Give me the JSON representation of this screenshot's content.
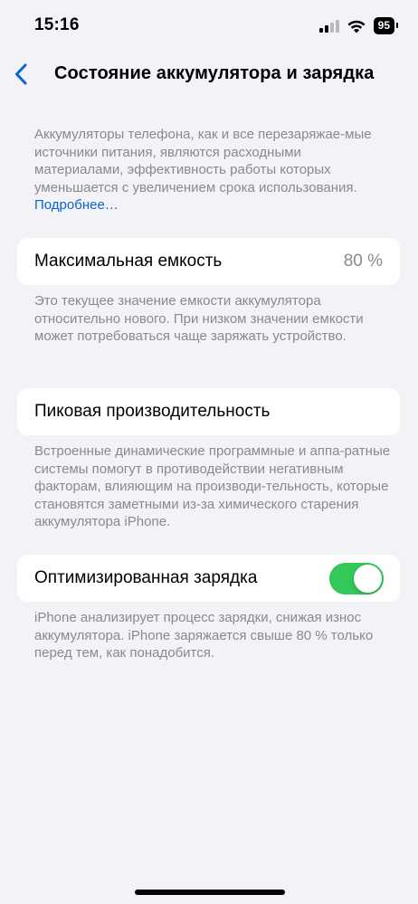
{
  "status_bar": {
    "time": "15:16",
    "battery_level": "95"
  },
  "nav": {
    "back_icon": "chevron-left-icon",
    "title": "Состояние аккумулятора и зарядка"
  },
  "intro": {
    "text": "Аккумуляторы телефона, как и все перезаряжае-мые источники питания, являются расходными материалами, эффективность работы которых уменьшается с увеличением срока использования.",
    "link": "Подробнее…"
  },
  "max_capacity": {
    "label": "Максимальная емкость",
    "value": "80 %",
    "footnote": "Это текущее значение емкости аккумулятора относительно нового. При низком значении емкости может потребоваться чаще заряжать устройство."
  },
  "peak_performance": {
    "label": "Пиковая производительность",
    "footnote": "Встроенные динамические программные и аппа-ратные системы помогут в противодействии негативным факторам, влияющим на производи-тельность, которые становятся заметными из-за химического старения аккумулятора iPhone."
  },
  "optimized_charging": {
    "label": "Оптимизированная зарядка",
    "enabled": true,
    "footnote": "iPhone анализирует процесс зарядки, снижая износ аккумулятора. iPhone заряжается свыше 80 % только перед тем, как понадобится."
  },
  "colors": {
    "accent": "#0a63d6",
    "toggle_on": "#34c759",
    "background": "#f2f2f7",
    "secondary_text": "#8a8a8e"
  }
}
